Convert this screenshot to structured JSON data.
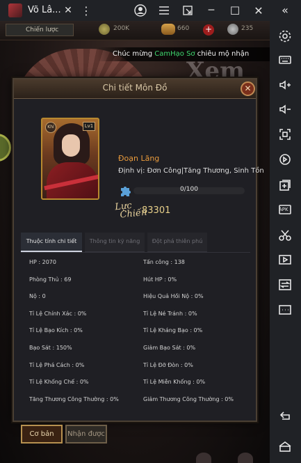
{
  "window": {
    "title": "Võ Lâ...",
    "close_tab_glyph": "✕",
    "menu_glyph": "⋮"
  },
  "title_controls": {
    "account_icon": "account-icon",
    "hamburger_icon": "menu-icon",
    "popout_icon": "popout-icon",
    "minimize_glyph": "─",
    "maximize_glyph": "☐",
    "close_glyph": "✕",
    "collapse_glyph": "«"
  },
  "sidebar": {
    "items": [
      "settings-icon",
      "keyboard-icon",
      "volume-up-icon",
      "volume-down-icon",
      "fullscreen-icon",
      "sync-icon",
      "add-window-icon",
      "apk-install-icon",
      "cut-icon",
      "video-icon",
      "transfer-icon",
      "more-icon"
    ],
    "apk_label": "APK",
    "back_icon": "back-icon",
    "home_icon": "home-icon"
  },
  "game": {
    "hud": {
      "tab_label": "Chiến lược",
      "gold": "200K",
      "ingots": "660",
      "other": "235",
      "plus_glyph": "+"
    },
    "notification": {
      "prefix": "Chúc mừng ",
      "name": "CamHạo Sơ",
      "suffix": " chiêu mộ nhận"
    },
    "background_text": "Xem"
  },
  "modal": {
    "title": "Chi tiết Môn Đồ",
    "close_glyph": "✕",
    "hero": {
      "badge_left": "Khí",
      "level": "Lv1",
      "name": "Đoạn Lãng",
      "role": "Định vị: Đơn Công|Tăng Thương, Sinh Tồn",
      "xp": "0/100",
      "xp_fraction": 0,
      "power_label_line1": "Lực",
      "power_label_line2": "Chiến",
      "power": "83301"
    },
    "tabs": [
      {
        "label": "Thuộc tính chi tiết",
        "active": true
      },
      {
        "label": "Thông tin kỹ năng",
        "active": false
      },
      {
        "label": "Đột phá thiên phú",
        "active": false
      }
    ],
    "stats_left": [
      "HP : 2070",
      "Phòng Thủ : 69",
      "Nộ : 0",
      "Tỉ Lệ Chính Xác : 0%",
      "Tỉ Lệ Bạo Kích : 0%",
      "Bạo Sát : 150%",
      "Tỉ Lệ Phá Cách : 0%",
      "Tỉ Lệ Khống Chế : 0%",
      "Tăng Thương Công Thường : 0%"
    ],
    "stats_right": [
      "Tấn công : 138",
      "Hút HP : 0%",
      "Hiệu Quả Hồi Nộ : 0%",
      "Tỉ Lệ Né Tránh : 0%",
      "Tỉ Lệ Kháng Bạo : 0%",
      "Giảm Bạo Sát : 0%",
      "Tỉ Lệ Đỡ Đòn : 0%",
      "Tỉ Lệ Miễn Khống : 0%",
      "Giảm Thương Công Thường : 0%"
    ]
  },
  "bottom_buttons": {
    "basic": "Cơ bản",
    "receive": "Nhận được"
  },
  "colors": {
    "accent_orange": "#e89a3c",
    "highlight_green": "#3fd86f",
    "gold_text": "#e8d08a",
    "panel_bg": "#1f1f24"
  }
}
